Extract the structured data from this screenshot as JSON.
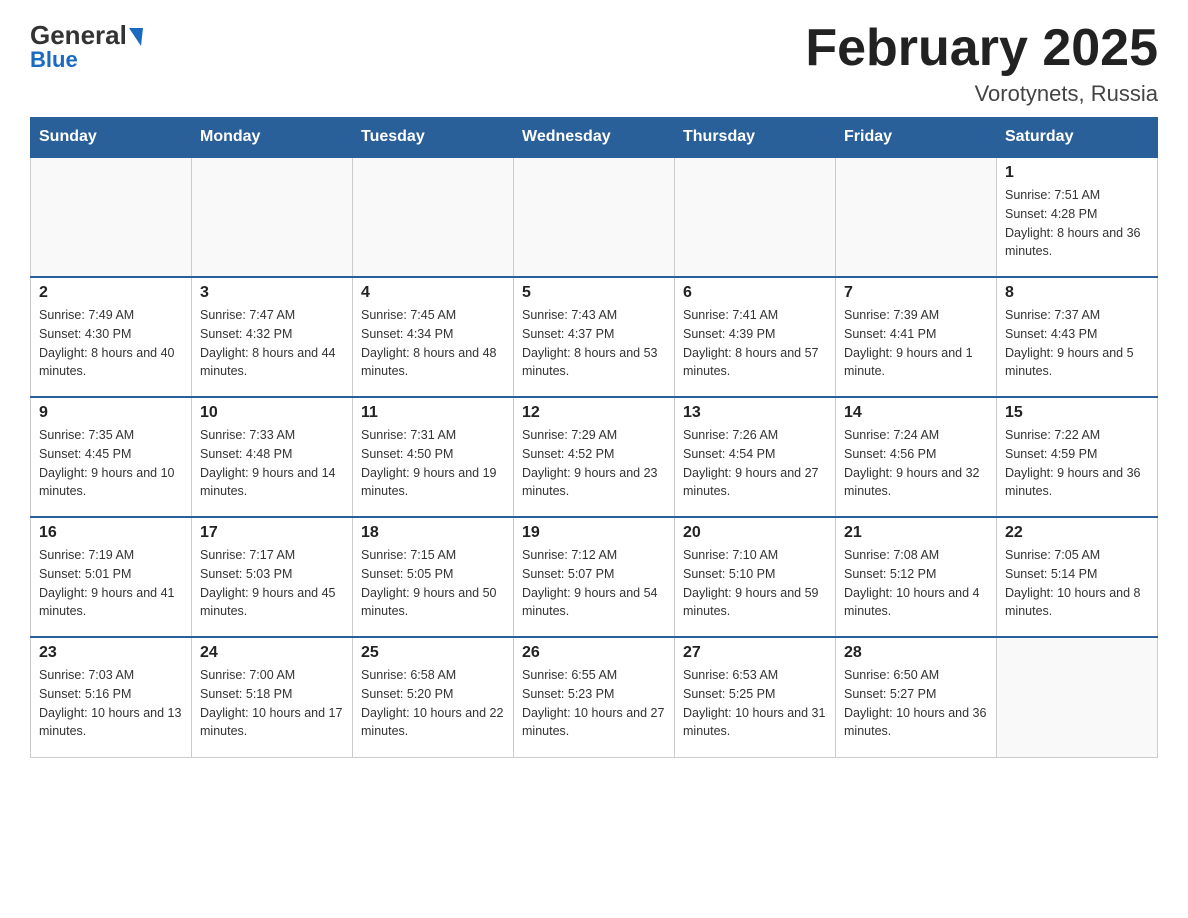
{
  "header": {
    "logo_top": "General",
    "logo_bottom": "Blue",
    "month_title": "February 2025",
    "location": "Vorotynets, Russia"
  },
  "days_of_week": [
    "Sunday",
    "Monday",
    "Tuesday",
    "Wednesday",
    "Thursday",
    "Friday",
    "Saturday"
  ],
  "weeks": [
    [
      {
        "day": "",
        "info": ""
      },
      {
        "day": "",
        "info": ""
      },
      {
        "day": "",
        "info": ""
      },
      {
        "day": "",
        "info": ""
      },
      {
        "day": "",
        "info": ""
      },
      {
        "day": "",
        "info": ""
      },
      {
        "day": "1",
        "info": "Sunrise: 7:51 AM\nSunset: 4:28 PM\nDaylight: 8 hours and 36 minutes."
      }
    ],
    [
      {
        "day": "2",
        "info": "Sunrise: 7:49 AM\nSunset: 4:30 PM\nDaylight: 8 hours and 40 minutes."
      },
      {
        "day": "3",
        "info": "Sunrise: 7:47 AM\nSunset: 4:32 PM\nDaylight: 8 hours and 44 minutes."
      },
      {
        "day": "4",
        "info": "Sunrise: 7:45 AM\nSunset: 4:34 PM\nDaylight: 8 hours and 48 minutes."
      },
      {
        "day": "5",
        "info": "Sunrise: 7:43 AM\nSunset: 4:37 PM\nDaylight: 8 hours and 53 minutes."
      },
      {
        "day": "6",
        "info": "Sunrise: 7:41 AM\nSunset: 4:39 PM\nDaylight: 8 hours and 57 minutes."
      },
      {
        "day": "7",
        "info": "Sunrise: 7:39 AM\nSunset: 4:41 PM\nDaylight: 9 hours and 1 minute."
      },
      {
        "day": "8",
        "info": "Sunrise: 7:37 AM\nSunset: 4:43 PM\nDaylight: 9 hours and 5 minutes."
      }
    ],
    [
      {
        "day": "9",
        "info": "Sunrise: 7:35 AM\nSunset: 4:45 PM\nDaylight: 9 hours and 10 minutes."
      },
      {
        "day": "10",
        "info": "Sunrise: 7:33 AM\nSunset: 4:48 PM\nDaylight: 9 hours and 14 minutes."
      },
      {
        "day": "11",
        "info": "Sunrise: 7:31 AM\nSunset: 4:50 PM\nDaylight: 9 hours and 19 minutes."
      },
      {
        "day": "12",
        "info": "Sunrise: 7:29 AM\nSunset: 4:52 PM\nDaylight: 9 hours and 23 minutes."
      },
      {
        "day": "13",
        "info": "Sunrise: 7:26 AM\nSunset: 4:54 PM\nDaylight: 9 hours and 27 minutes."
      },
      {
        "day": "14",
        "info": "Sunrise: 7:24 AM\nSunset: 4:56 PM\nDaylight: 9 hours and 32 minutes."
      },
      {
        "day": "15",
        "info": "Sunrise: 7:22 AM\nSunset: 4:59 PM\nDaylight: 9 hours and 36 minutes."
      }
    ],
    [
      {
        "day": "16",
        "info": "Sunrise: 7:19 AM\nSunset: 5:01 PM\nDaylight: 9 hours and 41 minutes."
      },
      {
        "day": "17",
        "info": "Sunrise: 7:17 AM\nSunset: 5:03 PM\nDaylight: 9 hours and 45 minutes."
      },
      {
        "day": "18",
        "info": "Sunrise: 7:15 AM\nSunset: 5:05 PM\nDaylight: 9 hours and 50 minutes."
      },
      {
        "day": "19",
        "info": "Sunrise: 7:12 AM\nSunset: 5:07 PM\nDaylight: 9 hours and 54 minutes."
      },
      {
        "day": "20",
        "info": "Sunrise: 7:10 AM\nSunset: 5:10 PM\nDaylight: 9 hours and 59 minutes."
      },
      {
        "day": "21",
        "info": "Sunrise: 7:08 AM\nSunset: 5:12 PM\nDaylight: 10 hours and 4 minutes."
      },
      {
        "day": "22",
        "info": "Sunrise: 7:05 AM\nSunset: 5:14 PM\nDaylight: 10 hours and 8 minutes."
      }
    ],
    [
      {
        "day": "23",
        "info": "Sunrise: 7:03 AM\nSunset: 5:16 PM\nDaylight: 10 hours and 13 minutes."
      },
      {
        "day": "24",
        "info": "Sunrise: 7:00 AM\nSunset: 5:18 PM\nDaylight: 10 hours and 17 minutes."
      },
      {
        "day": "25",
        "info": "Sunrise: 6:58 AM\nSunset: 5:20 PM\nDaylight: 10 hours and 22 minutes."
      },
      {
        "day": "26",
        "info": "Sunrise: 6:55 AM\nSunset: 5:23 PM\nDaylight: 10 hours and 27 minutes."
      },
      {
        "day": "27",
        "info": "Sunrise: 6:53 AM\nSunset: 5:25 PM\nDaylight: 10 hours and 31 minutes."
      },
      {
        "day": "28",
        "info": "Sunrise: 6:50 AM\nSunset: 5:27 PM\nDaylight: 10 hours and 36 minutes."
      },
      {
        "day": "",
        "info": ""
      }
    ]
  ]
}
